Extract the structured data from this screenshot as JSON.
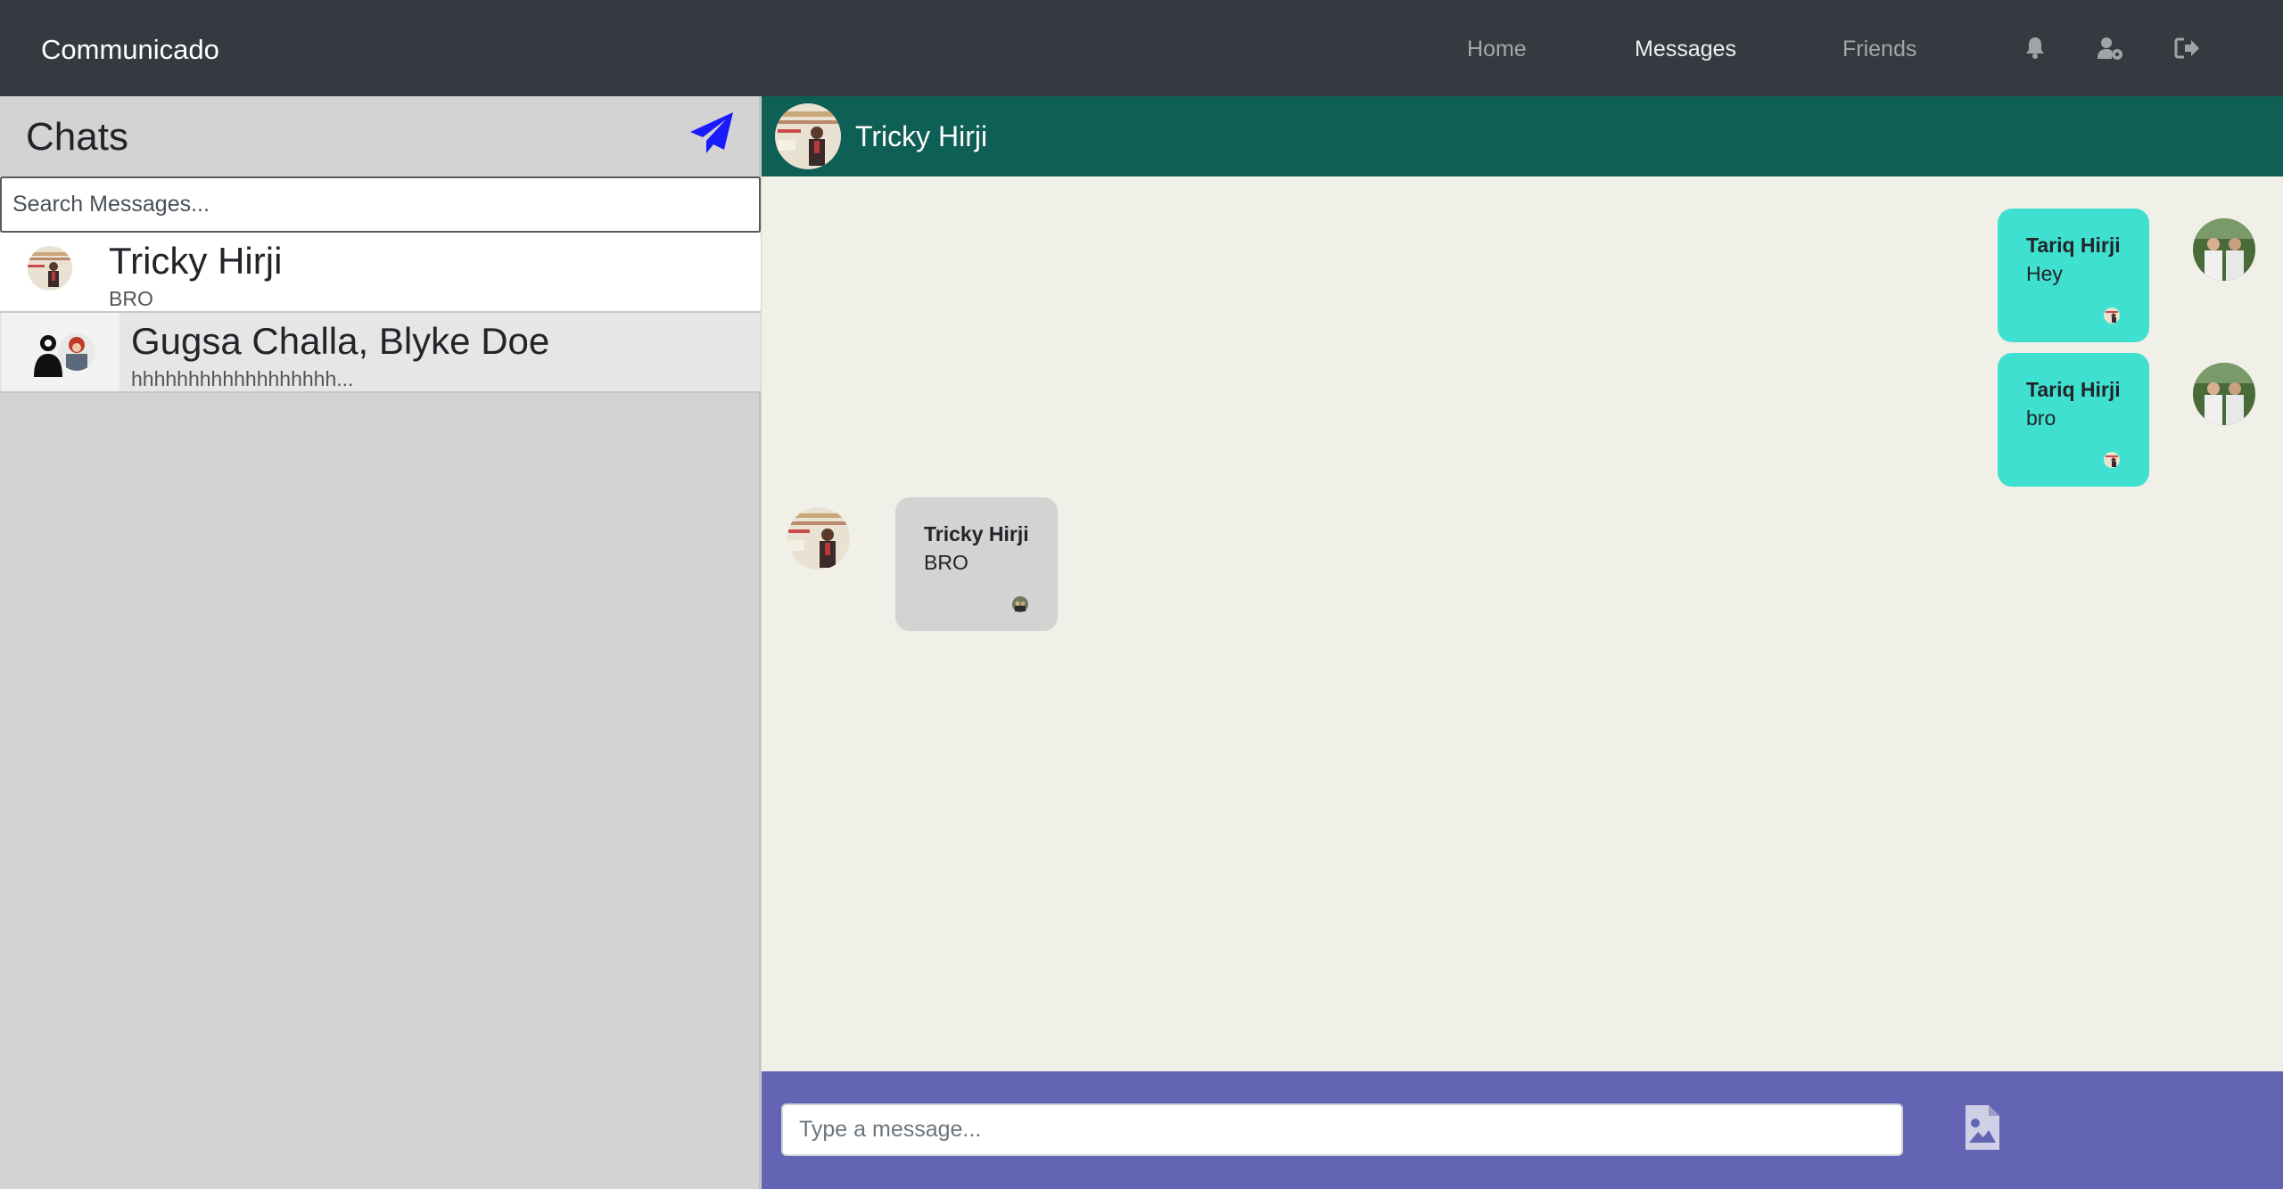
{
  "navbar": {
    "brand": "Communicado",
    "links": [
      {
        "label": "Home",
        "active": false
      },
      {
        "label": "Messages",
        "active": true
      },
      {
        "label": "Friends",
        "active": false
      }
    ],
    "icons": [
      "bell-icon",
      "user-gear-icon",
      "sign-out-icon"
    ]
  },
  "sidebar": {
    "title": "Chats",
    "compose_icon": "paper-plane-icon",
    "search": {
      "placeholder": "Search Messages...",
      "value": ""
    },
    "chats": [
      {
        "name": "Tricky Hirji",
        "preview": "BRO",
        "selected": true
      },
      {
        "name": "Gugsa Challa, Blyke Doe",
        "preview": "hhhhhhhhhhhhhhhhhh...",
        "selected": false
      }
    ]
  },
  "chat": {
    "header_name": "Tricky Hirji",
    "messages": [
      {
        "sender": "Tariq Hirji",
        "text": "Hey",
        "direction": "outgoing"
      },
      {
        "sender": "Tariq Hirji",
        "text": "bro",
        "direction": "outgoing"
      },
      {
        "sender": "Tricky Hirji",
        "text": "BRO",
        "direction": "incoming"
      }
    ],
    "composer": {
      "placeholder": "Type a message...",
      "value": ""
    },
    "attach_icon": "file-image-icon"
  },
  "colors": {
    "navbar_bg": "#343a40",
    "header_bg": "#0e5f55",
    "outgoing_bubble": "#40e0d0",
    "incoming_bubble": "#d3d3d3",
    "composer_bg": "#6464b4",
    "send_icon": "#1a1aff"
  }
}
